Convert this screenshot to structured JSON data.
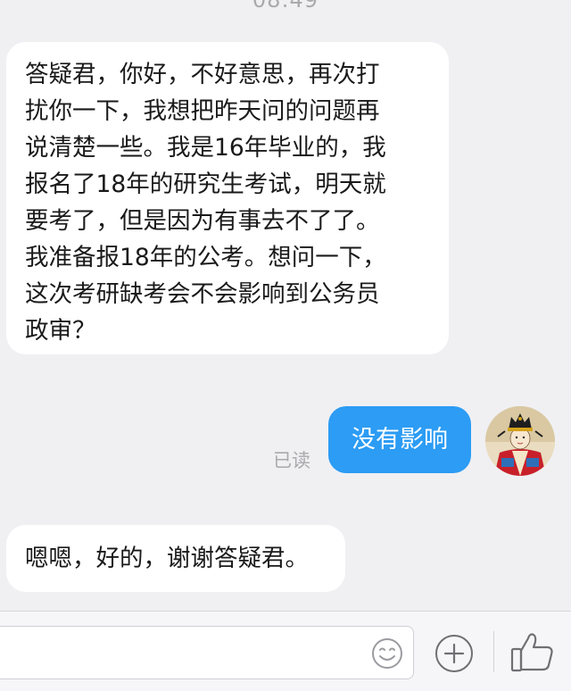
{
  "chat": {
    "timestamp": "08:49",
    "messages": [
      {
        "direction": "incoming",
        "lines": [
          "答疑君，你好，不好意思，再次打",
          "扰你一下，我想把昨天问的问题再",
          "说清楚一些。我是16年毕业的，我",
          "报名了18年的研究生考试，明天就",
          "要考了，但是因为有事去不了了。",
          "我准备报18年的公考。想问一下，",
          "这次考研缺考会不会影响到公务员",
          "政审？"
        ]
      },
      {
        "direction": "outgoing",
        "text": "没有影响",
        "status": "已读"
      },
      {
        "direction": "incoming",
        "text": "嗯嗯，好的，谢谢答疑君。"
      }
    ]
  },
  "input_bar": {
    "value": "",
    "icons": {
      "emoji": "smiley-face-icon",
      "plus": "plus-circle-icon",
      "like": "thumbs-up-icon"
    }
  },
  "colors": {
    "background": "#f0f0f3",
    "incoming_bubble": "#ffffff",
    "outgoing_bubble": "#2c9cf4",
    "muted_text": "#a9a9ae"
  }
}
